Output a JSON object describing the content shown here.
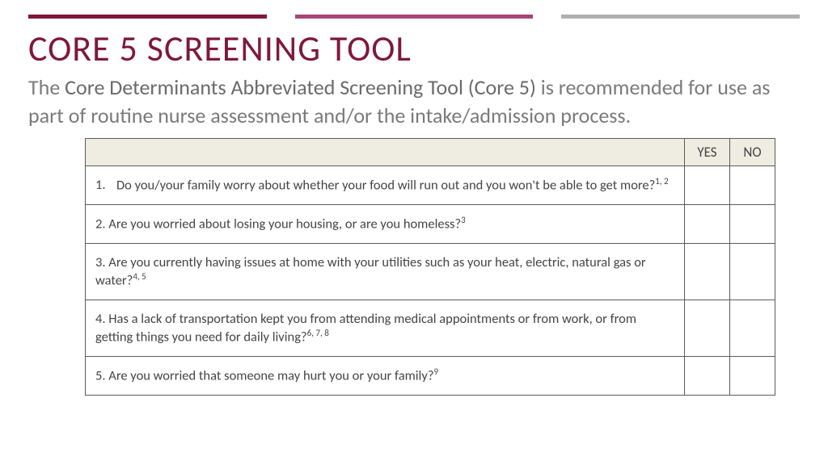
{
  "title": "CORE 5 SCREENING TOOL",
  "subtitle_prefix": "The ",
  "subtitle_bold": "Core Determinants Abbreviated Screening Tool (Core 5)",
  "subtitle_suffix": " is recommended for use as part of routine nurse assessment and/or the intake/admission process.",
  "headers": {
    "yes": "YES",
    "no": "NO"
  },
  "questions": [
    {
      "num": "1.",
      "text": "Do you/your family worry about whether your food will run out and you won't be able to get more?",
      "refs": "1, 2",
      "indent": true
    },
    {
      "num": "2.",
      "text": "Are you worried about losing your housing, or are you homeless?",
      "refs": "3",
      "indent": false
    },
    {
      "num": "3.",
      "text": "Are you currently having issues at home with your utilities such as your heat, electric, natural gas or water?",
      "refs": "4, 5",
      "indent": false
    },
    {
      "num": "4.",
      "text": "Has a lack of transportation kept you from attending medical appointments or from work, or from getting things you need for daily living?",
      "refs": "6, 7, 8",
      "indent": false
    },
    {
      "num": "5.",
      "text": "Are you worried that someone may hurt you or your family?",
      "refs": "9",
      "indent": false
    }
  ]
}
